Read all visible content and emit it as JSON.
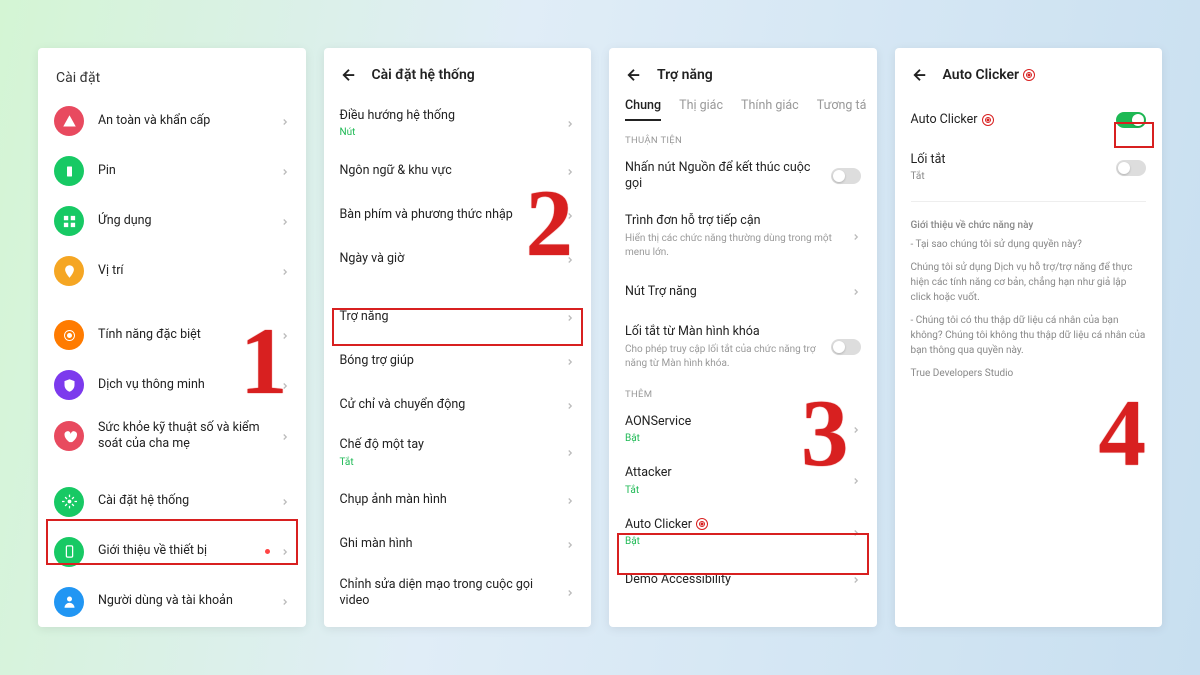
{
  "steps": [
    "1",
    "2",
    "3",
    "4"
  ],
  "p1": {
    "title": "Cài đặt",
    "rows": [
      {
        "icon": "alert",
        "color": "#e84a5f",
        "label": "An toàn và khẩn cấp"
      },
      {
        "icon": "battery",
        "color": "#17c964",
        "label": "Pin"
      },
      {
        "icon": "grid",
        "color": "#17c964",
        "label": "Ứng dụng"
      },
      {
        "icon": "location",
        "color": "#f5a623",
        "label": "Vị trí"
      },
      {
        "gap": true
      },
      {
        "icon": "star",
        "color": "#ff7b00",
        "label": "Tính năng đặc biệt"
      },
      {
        "icon": "shield",
        "color": "#7c3aed",
        "label": "Dịch vụ thông minh"
      },
      {
        "icon": "heart",
        "color": "#e84a5f",
        "label": "Sức khỏe kỹ thuật số và kiểm soát của cha mẹ"
      },
      {
        "gap": true
      },
      {
        "icon": "gear",
        "color": "#17c964",
        "label": "Cài đặt hệ thống",
        "highlight": true
      },
      {
        "icon": "phone",
        "color": "#17c964",
        "label": "Giới thiệu về thiết bị",
        "dot": true
      },
      {
        "icon": "user",
        "color": "#2196f3",
        "label": "Người dùng và tài khoản"
      }
    ]
  },
  "p2": {
    "title": "Cài đặt hệ thống",
    "rows": [
      {
        "label": "Điều hướng hệ thống",
        "sub": "Nút",
        "green": true
      },
      {
        "label": "Ngôn ngữ & khu vực"
      },
      {
        "label": "Bàn phím và phương thức nhập"
      },
      {
        "label": "Ngày và giờ"
      },
      {
        "gap": true
      },
      {
        "label": "Trợ năng",
        "highlight": true
      },
      {
        "label": "Bóng trợ giúp"
      },
      {
        "label": "Cử chỉ và chuyển động"
      },
      {
        "label": "Chế độ một tay",
        "sub": "Tắt",
        "green": true
      },
      {
        "label": "Chụp ảnh màn hình"
      },
      {
        "label": "Ghi màn hình"
      },
      {
        "label": "Chỉnh sửa diện mạo trong cuộc gọi video"
      }
    ]
  },
  "p3": {
    "title": "Trợ năng",
    "tabs": [
      "Chung",
      "Thị giác",
      "Thính giác",
      "Tương tá"
    ],
    "section1": "THUẬN TIỆN",
    "rows1": [
      {
        "label": "Nhấn nút Nguồn để kết thúc cuộc gọi",
        "toggle": false
      },
      {
        "label": "Trình đơn hỗ trợ tiếp cận",
        "desc": "Hiển thị các chức năng thường dùng trong một menu lớn."
      },
      {
        "label": "Nút Trợ năng"
      },
      {
        "label": "Lối tắt từ Màn hình khóa",
        "desc": "Cho phép truy cập lối tắt của chức năng trợ năng từ Màn hình khóa.",
        "toggle": false
      }
    ],
    "section2": "THÊM",
    "rows2": [
      {
        "label": "AONService",
        "sub": "Bật",
        "green": true
      },
      {
        "label": "Attacker",
        "sub": "Tắt",
        "green": true
      },
      {
        "label": "Auto Clicker",
        "sub": "Bật",
        "green": true,
        "target": true,
        "highlight": true
      },
      {
        "label": "Demo Accessibility"
      }
    ]
  },
  "p4": {
    "title": "Auto Clicker",
    "main": {
      "label": "Auto Clicker",
      "toggle": true,
      "highlight": true
    },
    "shortcut": {
      "label": "Lối tắt",
      "sub": "Tắt"
    },
    "info": {
      "heading": "Giới thiệu về chức năng này",
      "p1": "- Tại sao chúng tôi sử dụng quyền này?",
      "p2": "Chúng tôi sử dụng Dịch vụ hỗ trợ/trợ năng để thực hiện các tính năng cơ bản, chẳng hạn như giả lập click hoặc vuốt.",
      "p3": "- Chúng tôi có thu thập dữ liệu cá nhân của bạn không? Chúng tôi không thu thập dữ liệu cá nhân của bạn thông qua quyền này.",
      "dev": "True Developers Studio"
    }
  }
}
